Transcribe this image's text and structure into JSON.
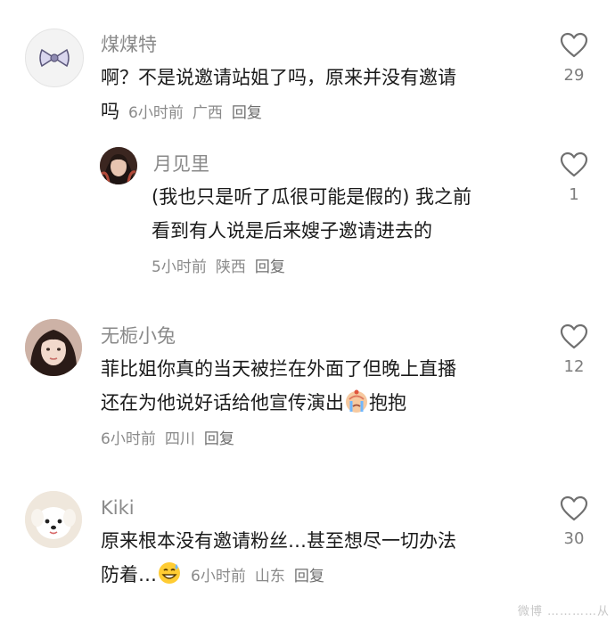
{
  "comments": [
    {
      "username": "煤煤特",
      "text": "啊？不是说邀请站姐了吗，原来并没有邀请吗",
      "text_line1": "啊？不是说邀请站姐了吗，原来并没有邀请",
      "text_line2": "吗",
      "time": "6小时前",
      "location": "广西",
      "reply": "回复",
      "likes": "29",
      "avatar_icon": "bow-icon"
    },
    {
      "username": "月见里",
      "text_line1": "(我也只是听了瓜很可能是假的) 我之前",
      "text_line2": "看到有人说是后来嫂子邀请进去的",
      "time": "5小时前",
      "location": "陕西",
      "reply": "回复",
      "likes": "1",
      "avatar_icon": "portrait-photo"
    },
    {
      "username": "无栀小兔",
      "text_line1": "菲比姐你真的当天被拦在外面了但晚上直播",
      "text_line2a": "还在为他说好话给他宣传演出",
      "text_line2b": "抱抱",
      "time": "6小时前",
      "location": "四川",
      "reply": "回复",
      "likes": "12",
      "avatar_icon": "portrait-photo",
      "emoji": "crying-face-emoji"
    },
    {
      "username": "Kiki",
      "text_line1": "原来根本没有邀请粉丝…甚至想尽一切办法",
      "text_line2": "防着…",
      "time": "6小时前",
      "location": "山东",
      "reply": "回复",
      "likes": "30",
      "avatar_icon": "white-dog-photo",
      "emoji": "sweat-smile-emoji"
    }
  ],
  "watermark": "微博 …………从",
  "colors": {
    "username": "#8a8a8a",
    "text": "#1a1a1a",
    "meta": "#8a8a8a"
  }
}
